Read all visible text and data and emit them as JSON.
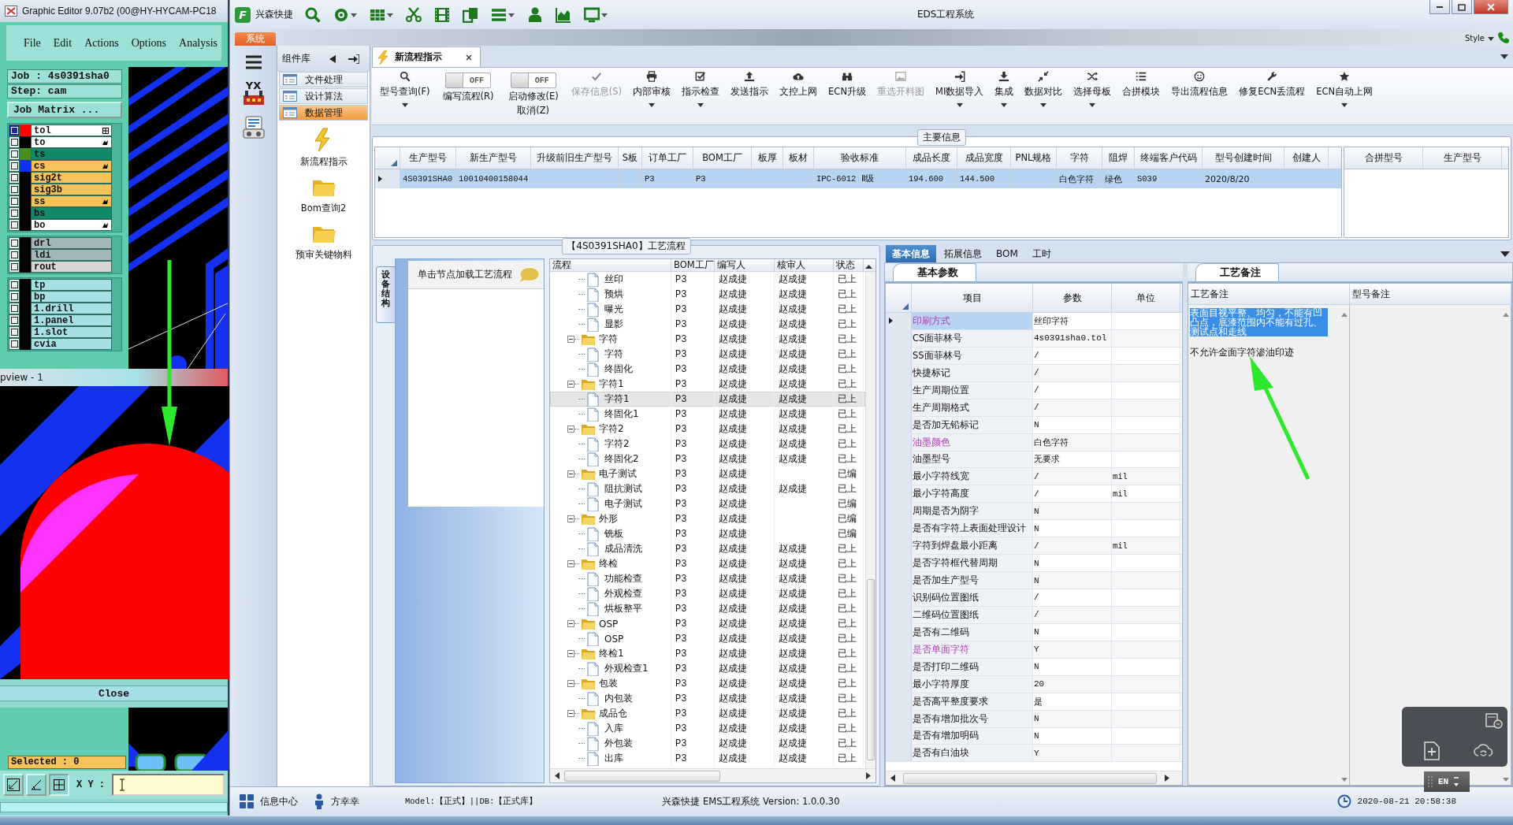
{
  "editor": {
    "title": "Graphic Editor 9.07b2 (00@HY-HYCAM-PC18",
    "menu": [
      "File",
      "Edit",
      "Actions",
      "Options",
      "Analysis"
    ],
    "job": "Job : 4s0391sha0",
    "step": "Step: cam",
    "matrix_button": "Job Matrix ...",
    "layer_groups": [
      [
        {
          "name": "tol",
          "kind": "plain",
          "color": "#ff0000",
          "pointer": false,
          "grid": true,
          "selected": true
        },
        {
          "name": "to",
          "kind": "plain",
          "pointer": true,
          "grid": false,
          "selected": false
        },
        {
          "name": "ts",
          "kind": "mask",
          "color": "#4a8f1c",
          "pointer": false,
          "grid": false,
          "selected": false
        },
        {
          "name": "cs",
          "kind": "signal",
          "color": "#1030ff",
          "pointer": true,
          "grid": false,
          "selected": false
        },
        {
          "name": "sig2t",
          "kind": "signal",
          "pointer": false,
          "grid": false,
          "selected": false
        },
        {
          "name": "sig3b",
          "kind": "signal",
          "pointer": false,
          "grid": false,
          "selected": false
        },
        {
          "name": "ss",
          "kind": "signal",
          "pointer": true,
          "grid": false,
          "selected": false
        },
        {
          "name": "bs",
          "kind": "mask",
          "pointer": false,
          "grid": false,
          "selected": false
        },
        {
          "name": "bo",
          "kind": "plain",
          "pointer": true,
          "grid": false,
          "selected": false
        }
      ],
      [
        {
          "name": "drl",
          "kind": "drill",
          "selected": false
        },
        {
          "name": "ldi",
          "kind": "drill",
          "selected": false
        },
        {
          "name": "rout",
          "kind": "rout",
          "selected": false
        }
      ],
      [
        {
          "name": "tp",
          "kind": "doc",
          "selected": false
        },
        {
          "name": "bp",
          "kind": "doc",
          "selected": false
        },
        {
          "name": "1.drill",
          "kind": "doc",
          "selected": false
        },
        {
          "name": "1.panel",
          "kind": "doc",
          "selected": false
        },
        {
          "name": "1.slot",
          "kind": "doc",
          "selected": false
        },
        {
          "name": "cvia",
          "kind": "doc",
          "selected": false
        }
      ]
    ],
    "popview_title": "pview - 1",
    "close_button": "Close",
    "selected_count": "Selected : 0",
    "xy_label": "X Y :"
  },
  "eds": {
    "logo_letter": "F",
    "brand": "兴森快捷",
    "title": "EDS工程系统",
    "system_tab": "系统",
    "style_menu": "Style",
    "rail_logo": "YX",
    "library": {
      "title": "组件库",
      "categories": [
        {
          "label": "文件处理",
          "selected": false
        },
        {
          "label": "设计算法",
          "selected": false
        },
        {
          "label": "数据管理",
          "selected": true
        }
      ],
      "tools": [
        "新流程指示",
        "Bom查询2",
        "预审关键物料"
      ]
    },
    "doc_tab": "新流程指示",
    "toolbar": [
      {
        "kind": "button",
        "label": "型号查询(F)",
        "menu": true,
        "disabled": false
      },
      {
        "kind": "toggle",
        "label": "编写流程(R)",
        "toggle_text": "OFF",
        "on": false
      },
      {
        "kind": "toggle",
        "label": "启动修改(E)",
        "second_line": "取消(Z)",
        "toggle_text": "OFF",
        "on": false
      },
      {
        "kind": "button",
        "label": "保存信息(S)",
        "menu": false,
        "disabled": true
      },
      {
        "kind": "button",
        "label": "内部审核",
        "menu": true,
        "disabled": false
      },
      {
        "kind": "button",
        "label": "指示检查",
        "menu": true,
        "disabled": false
      },
      {
        "kind": "button",
        "label": "发送指示",
        "menu": false,
        "disabled": false
      },
      {
        "kind": "button",
        "label": "文控上网",
        "menu": false,
        "disabled": false
      },
      {
        "kind": "button",
        "label": "ECN升级",
        "menu": false,
        "disabled": false
      },
      {
        "kind": "button",
        "label": "重选开料图",
        "menu": false,
        "disabled": true
      },
      {
        "kind": "button",
        "label": "MI数据导入",
        "menu": true,
        "disabled": false
      },
      {
        "kind": "button",
        "label": "集成",
        "menu": true,
        "disabled": false
      },
      {
        "kind": "button",
        "label": "数据对比",
        "menu": true,
        "disabled": false
      },
      {
        "kind": "button",
        "label": "选择母板",
        "menu": true,
        "disabled": false
      },
      {
        "kind": "button",
        "label": "合拼模块",
        "menu": false,
        "disabled": false
      },
      {
        "kind": "button",
        "label": "导出流程信息",
        "menu": false,
        "disabled": false
      },
      {
        "kind": "button",
        "label": "修复ECN丢流程",
        "menu": false,
        "disabled": false
      },
      {
        "kind": "button",
        "label": "ECN自动上网",
        "menu": true,
        "disabled": false
      }
    ],
    "main_info": {
      "title": "主要信息",
      "columns": [
        "生产型号",
        "新生产型号",
        "升级前旧生产型号",
        "S板",
        "订单工厂",
        "BOM工厂",
        "板厚",
        "板材",
        "验收标准",
        "成品长度",
        "成品宽度",
        "PNL规格",
        "字符",
        "阻焊",
        "终端客户代码",
        "型号创建时间",
        "创建人"
      ],
      "rows": [
        {
          "selected": true,
          "cells": [
            "4S0391SHA0",
            "10010400158044",
            null,
            null,
            "P3",
            "P3",
            null,
            null,
            "IPC-6012 Ⅱ级",
            "194.600",
            "144.500",
            null,
            "白色字符",
            "绿色",
            "S039",
            "2020/8/20",
            null
          ]
        }
      ],
      "merge_columns": [
        "合拼型号",
        "生产型号"
      ]
    },
    "process": {
      "title": "【4S0391SHA0】工艺流程",
      "side_tab": "设备结构",
      "hint": "单击节点加载工艺流程",
      "columns": [
        "流程",
        "BOM工厂",
        "编写人",
        "核审人",
        "状态"
      ],
      "tree": [
        {
          "children": [
            {
              "label": "丝印",
              "bom": "P3",
              "writer": "赵成捷",
              "reviewer": "赵成捷",
              "status": "已上",
              "selected": false
            },
            {
              "label": "预烘",
              "bom": "P3",
              "writer": "赵成捷",
              "reviewer": "赵成捷",
              "status": "已上",
              "selected": false
            },
            {
              "label": "曝光",
              "bom": "P3",
              "writer": "赵成捷",
              "reviewer": "赵成捷",
              "status": "已上",
              "selected": false
            },
            {
              "label": "显影",
              "bom": "P3",
              "writer": "赵成捷",
              "reviewer": "赵成捷",
              "status": "已上",
              "selected": false
            }
          ]
        },
        {
          "label": "字符",
          "bom": "P3",
          "writer": "赵成捷",
          "reviewer": "赵成捷",
          "status": "已上",
          "selected": false,
          "expanded": true,
          "children": [
            {
              "label": "字符",
              "bom": "P3",
              "writer": "赵成捷",
              "reviewer": "赵成捷",
              "status": "已上",
              "selected": false
            },
            {
              "label": "终固化",
              "bom": "P3",
              "writer": "赵成捷",
              "reviewer": "赵成捷",
              "status": "已上",
              "selected": false
            }
          ]
        },
        {
          "label": "字符1",
          "bom": "P3",
          "writer": "赵成捷",
          "reviewer": "赵成捷",
          "status": "已上",
          "selected": false,
          "expanded": true,
          "children": [
            {
              "label": "字符1",
              "bom": "P3",
              "writer": "赵成捷",
              "reviewer": "赵成捷",
              "status": "已上",
              "selected": true
            },
            {
              "label": "终固化1",
              "bom": "P3",
              "writer": "赵成捷",
              "reviewer": "赵成捷",
              "status": "已上",
              "selected": false
            }
          ]
        },
        {
          "label": "字符2",
          "bom": "P3",
          "writer": "赵成捷",
          "reviewer": "赵成捷",
          "status": "已上",
          "selected": false,
          "expanded": true,
          "children": [
            {
              "label": "字符2",
              "bom": "P3",
              "writer": "赵成捷",
              "reviewer": "赵成捷",
              "status": "已上",
              "selected": false
            },
            {
              "label": "终固化2",
              "bom": "P3",
              "writer": "赵成捷",
              "reviewer": "赵成捷",
              "status": "已上",
              "selected": false
            }
          ]
        },
        {
          "label": "电子测试",
          "bom": "P3",
          "writer": "赵成捷",
          "status": "已编",
          "selected": false,
          "expanded": true,
          "children": [
            {
              "label": "阻抗测试",
              "bom": "P3",
              "writer": "赵成捷",
              "reviewer": "赵成捷",
              "status": "已上",
              "selected": false
            },
            {
              "label": "电子测试",
              "bom": "P3",
              "writer": "赵成捷",
              "status": "已编",
              "selected": false
            }
          ]
        },
        {
          "label": "外形",
          "bom": "P3",
          "writer": "赵成捷",
          "status": "已编",
          "selected": false,
          "expanded": true,
          "children": [
            {
              "label": "铣板",
              "bom": "P3",
              "writer": "赵成捷",
              "status": "已编",
              "selected": false
            },
            {
              "label": "成品清洗",
              "bom": "P3",
              "writer": "赵成捷",
              "reviewer": "赵成捷",
              "status": "已上",
              "selected": false
            }
          ]
        },
        {
          "label": "终检",
          "bom": "P3",
          "writer": "赵成捷",
          "reviewer": "赵成捷",
          "status": "已上",
          "selected": false,
          "expanded": true,
          "children": [
            {
              "label": "功能检查",
              "bom": "P3",
              "writer": "赵成捷",
              "reviewer": "赵成捷",
              "status": "已上",
              "selected": false
            },
            {
              "label": "外观检查",
              "bom": "P3",
              "writer": "赵成捷",
              "reviewer": "赵成捷",
              "status": "已上",
              "selected": false
            },
            {
              "label": "烘板整平",
              "bom": "P3",
              "writer": "赵成捷",
              "reviewer": "赵成捷",
              "status": "已上",
              "selected": false
            }
          ]
        },
        {
          "label": "OSP",
          "bom": "P3",
          "writer": "赵成捷",
          "reviewer": "赵成捷",
          "status": "已上",
          "selected": false,
          "expanded": true,
          "children": [
            {
              "label": "OSP",
              "bom": "P3",
              "writer": "赵成捷",
              "reviewer": "赵成捷",
              "status": "已上",
              "selected": false
            }
          ]
        },
        {
          "label": "终检1",
          "bom": "P3",
          "writer": "赵成捷",
          "reviewer": "赵成捷",
          "status": "已上",
          "selected": false,
          "expanded": true,
          "children": [
            {
              "label": "外观检查1",
              "bom": "P3",
              "writer": "赵成捷",
              "reviewer": "赵成捷",
              "status": "已上",
              "selected": false
            }
          ]
        },
        {
          "label": "包装",
          "bom": "P3",
          "writer": "赵成捷",
          "reviewer": "赵成捷",
          "status": "已上",
          "selected": false,
          "expanded": true,
          "children": [
            {
              "label": "内包装",
              "bom": "P3",
              "writer": "赵成捷",
              "reviewer": "赵成捷",
              "status": "已上",
              "selected": false
            }
          ]
        },
        {
          "label": "成品仓",
          "bom": "P3",
          "writer": "赵成捷",
          "reviewer": "赵成捷",
          "status": "已上",
          "selected": false,
          "expanded": true,
          "children": [
            {
              "label": "入库",
              "bom": "P3",
              "writer": "赵成捷",
              "reviewer": "赵成捷",
              "status": "已上",
              "selected": false
            },
            {
              "label": "外包装",
              "bom": "P3",
              "writer": "赵成捷",
              "reviewer": "赵成捷",
              "status": "已上",
              "selected": false
            },
            {
              "label": "出库",
              "bom": "P3",
              "writer": "赵成捷",
              "reviewer": "赵成捷",
              "status": "已上",
              "selected": false
            }
          ]
        }
      ]
    },
    "detail": {
      "tabs": [
        {
          "label": "基本信息",
          "selected": true
        },
        {
          "label": "拓展信息",
          "selected": false
        },
        {
          "label": "BOM",
          "selected": false
        },
        {
          "label": "工时",
          "selected": false
        }
      ],
      "params": {
        "tab": "基本参数",
        "columns": [
          "项目",
          "参数",
          "单位"
        ],
        "rows": [
          {
            "item": "印刷方式",
            "value": "丝印字符",
            "flagged": true,
            "selected": true
          },
          {
            "item": "CS面菲林号",
            "value": "4s0391sha0.tol",
            "flagged": false,
            "selected": false
          },
          {
            "item": "SS面菲林号",
            "value": "/",
            "flagged": false,
            "selected": false
          },
          {
            "item": "快捷标记",
            "value": "/",
            "flagged": false,
            "selected": false
          },
          {
            "item": "生产周期位置",
            "value": "/",
            "flagged": false,
            "selected": false
          },
          {
            "item": "生产周期格式",
            "value": "/",
            "flagged": false,
            "selected": false
          },
          {
            "item": "是否加无铅标记",
            "value": "N",
            "flagged": false,
            "selected": false
          },
          {
            "item": "油墨颜色",
            "value": "白色字符",
            "flagged": true,
            "selected": false
          },
          {
            "item": "油墨型号",
            "value": "无要求",
            "flagged": false,
            "selected": false
          },
          {
            "item": "最小字符线宽",
            "value": "/",
            "unit": "mil",
            "flagged": false,
            "selected": false
          },
          {
            "item": "最小字符高度",
            "value": "/",
            "unit": "mil",
            "flagged": false,
            "selected": false
          },
          {
            "item": "周期是否为阴字",
            "value": "N",
            "flagged": false,
            "selected": false
          },
          {
            "item": "是否有字符上表面处理设计",
            "value": "N",
            "flagged": false,
            "selected": false
          },
          {
            "item": "字符到焊盘最小距离",
            "value": "/",
            "unit": "mil",
            "flagged": false,
            "selected": false
          },
          {
            "item": "是否字符框代替周期",
            "value": "N",
            "flagged": false,
            "selected": false
          },
          {
            "item": "是否加生产型号",
            "value": "N",
            "flagged": false,
            "selected": false
          },
          {
            "item": "识别码位置图纸",
            "value": "/",
            "flagged": false,
            "selected": false
          },
          {
            "item": "二维码位置图纸",
            "value": "/",
            "flagged": false,
            "selected": false
          },
          {
            "item": "是否有二维码",
            "value": "N",
            "flagged": false,
            "selected": false
          },
          {
            "item": "是否单面字符",
            "value": "Y",
            "flagged": true,
            "selected": false
          },
          {
            "item": "是否打印二维码",
            "value": "N",
            "flagged": false,
            "selected": false
          },
          {
            "item": "最小字符厚度",
            "value": "20",
            "flagged": false,
            "selected": false
          },
          {
            "item": "是否高平整度要求",
            "value": "是",
            "flagged": false,
            "selected": false
          },
          {
            "item": "是否有增加批次号",
            "value": "N",
            "flagged": false,
            "selected": false
          },
          {
            "item": "是否有增加明码",
            "value": "N",
            "flagged": false,
            "selected": false
          },
          {
            "item": "是否有白油块",
            "value": "Y",
            "flagged": false,
            "selected": false
          }
        ]
      },
      "notes": {
        "tab": "工艺备注",
        "columns": [
          "工艺备注",
          "型号备注"
        ],
        "paragraphs": [
          {
            "text": "表面目视平整、均匀，不能有凹凸点，底漆范围内不能有过孔、测试点和走线",
            "selected": true
          },
          {
            "text": "不允许金面字符渗油印迹",
            "selected": false
          }
        ]
      },
      "ime": "EN"
    },
    "status_bar": {
      "info": "信息中心",
      "user": "方幸幸",
      "model": "Model:【正式】||DB:【正式库】",
      "product": "兴森快捷 EMS工程系统 Version: 1.0.0.30",
      "time": "2020-08-21 20:58:38"
    }
  }
}
